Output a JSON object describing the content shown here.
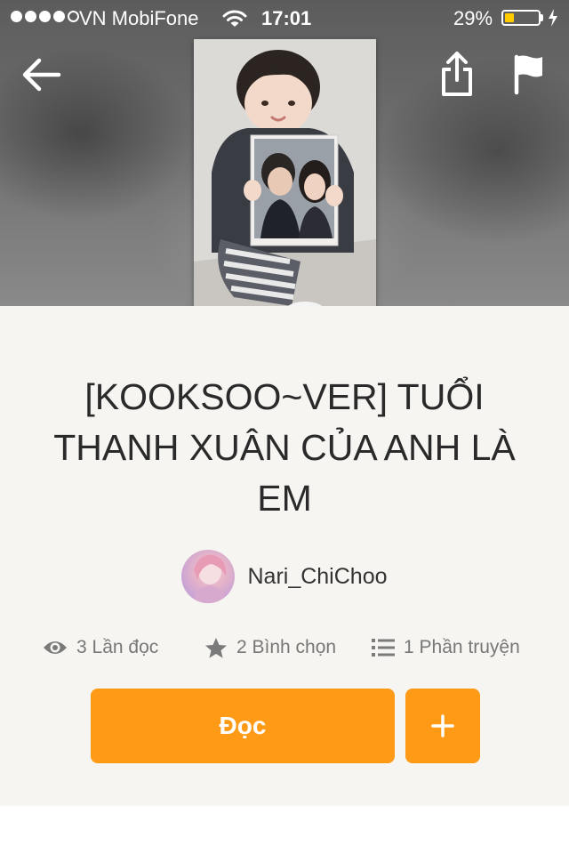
{
  "status_bar": {
    "carrier": "VN MobiFone",
    "time": "17:01",
    "battery_percent": "29%",
    "battery_level": 0.29,
    "signal_bars_filled": 4,
    "signal_bars_total": 5
  },
  "header": {
    "back_icon": "arrow-left-icon",
    "share_icon": "share-icon",
    "report_icon": "flag-icon"
  },
  "story": {
    "title": "[KOOKSOO~VER] TUỔI THANH XUÂN CỦA ANH LÀ EM",
    "author": "Nari_ChiChoo"
  },
  "stats": {
    "reads": "3 Lần đọc",
    "votes": "2 Bình chọn",
    "parts": "1 Phần truyện"
  },
  "actions": {
    "read_label": "Đọc",
    "add_icon": "plus-icon"
  },
  "colors": {
    "accent": "#ff9a16",
    "panel_background": "#f6f5f1",
    "title_text": "#2a2a2a",
    "meta_text": "#777777"
  }
}
